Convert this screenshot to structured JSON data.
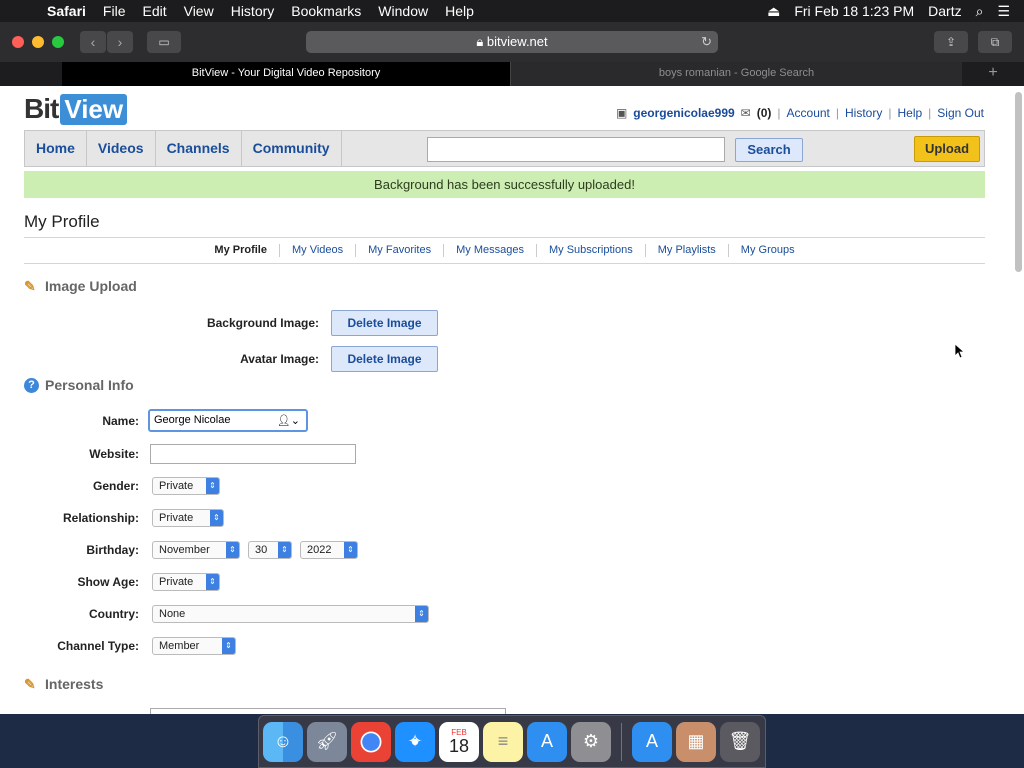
{
  "menubar": {
    "app": "Safari",
    "items": [
      "File",
      "Edit",
      "View",
      "History",
      "Bookmarks",
      "Window",
      "Help"
    ],
    "datetime": "Fri Feb 18  1:23 PM",
    "user": "Dartz"
  },
  "browser": {
    "url": "bitview.net",
    "tabs": [
      {
        "title": "BitView - Your Digital Video Repository"
      },
      {
        "title": "boys romanian - Google Search"
      }
    ]
  },
  "site": {
    "logo_bit": "Bit",
    "logo_view": "View",
    "user": {
      "username": "georgenicolae999",
      "messages_count": "(0)",
      "links": [
        "Account",
        "History",
        "Help",
        "Sign Out"
      ]
    },
    "nav": {
      "tabs": [
        "Home",
        "Videos",
        "Channels",
        "Community"
      ],
      "search_value": "",
      "search_label": "Search",
      "upload_label": "Upload"
    },
    "notice": "Background has been successfully uploaded!",
    "page_title": "My Profile",
    "subnav": [
      "My Profile",
      "My Videos",
      "My Favorites",
      "My Messages",
      "My Subscriptions",
      "My Playlists",
      "My Groups"
    ],
    "image_upload": {
      "heading": "Image Upload",
      "background_label": "Background Image:",
      "avatar_label": "Avatar Image:",
      "delete_label": "Delete Image"
    },
    "personal_info": {
      "heading": "Personal Info",
      "name_label": "Name:",
      "name_value": "George Nicolae",
      "website_label": "Website:",
      "website_value": "",
      "gender_label": "Gender:",
      "gender_value": "Private",
      "relationship_label": "Relationship:",
      "relationship_value": "Private",
      "birthday_label": "Birthday:",
      "birthday_month": "November",
      "birthday_day": "30",
      "birthday_year": "2022",
      "showage_label": "Show Age:",
      "showage_value": "Private",
      "country_label": "Country:",
      "country_value": "None",
      "channeltype_label": "Channel Type:",
      "channeltype_value": "Member"
    },
    "interests": {
      "heading": "Interests"
    }
  },
  "dock": {
    "apps": [
      "finder-icon",
      "launchpad-icon",
      "chrome-icon",
      "safari-icon",
      "calendar-icon",
      "notes-icon",
      "appstore-icon",
      "system-preferences-icon",
      "appstore-icon",
      "photos-icon",
      "trash-icon"
    ],
    "calendar_month": "FEB",
    "calendar_day": "18"
  }
}
